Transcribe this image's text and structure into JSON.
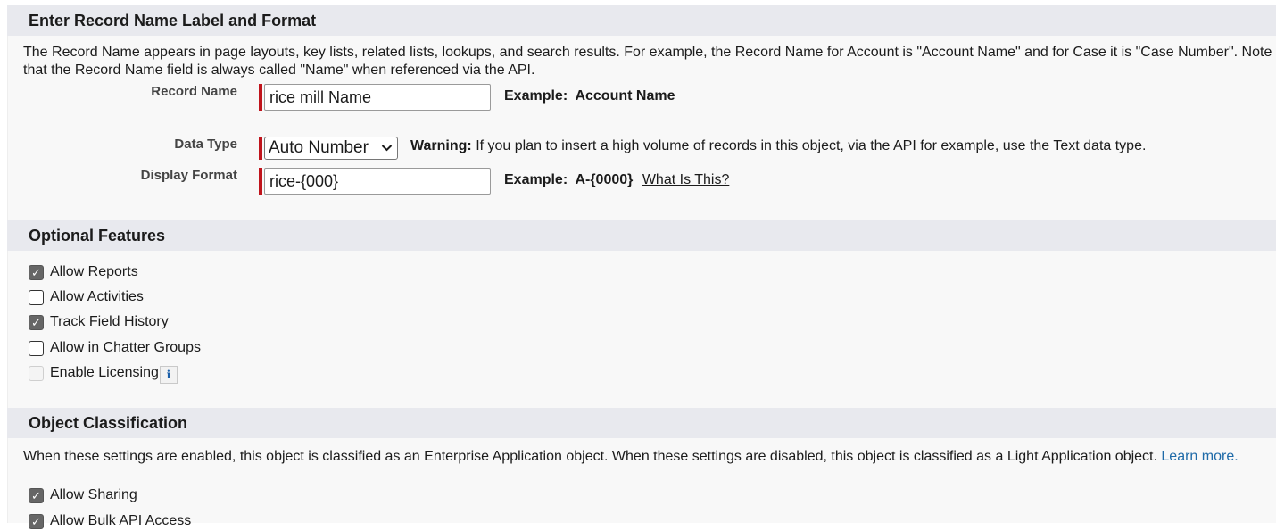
{
  "record_section": {
    "title": "Enter Record Name Label and Format",
    "description": "The Record Name appears in page layouts, key lists, related lists, lookups, and search results. For example, the Record Name for Account is \"Account Name\" and for Case it is \"Case Number\". Note that the Record Name field is always called \"Name\" when referenced via the API.",
    "record_name": {
      "label": "Record Name",
      "value": "rice mill Name",
      "example_prefix": "Example:",
      "example_value": "Account Name"
    },
    "data_type": {
      "label": "Data Type",
      "selected": "Auto Number",
      "warning_label": "Warning:",
      "warning_text": "If you plan to insert a high volume of records in this object, via the API for example, use the Text data type."
    },
    "display_format": {
      "label": "Display Format",
      "value": "rice-{000}",
      "example_prefix": "Example:",
      "example_value": "A-{0000}",
      "help_link": "What Is This?"
    }
  },
  "optional_section": {
    "title": "Optional Features",
    "items": [
      {
        "label": "Allow Reports",
        "checked": true,
        "disabled": false
      },
      {
        "label": "Allow Activities",
        "checked": false,
        "disabled": false
      },
      {
        "label": "Track Field History",
        "checked": true,
        "disabled": false
      },
      {
        "label": "Allow in Chatter Groups",
        "checked": false,
        "disabled": false
      },
      {
        "label": "Enable Licensing",
        "checked": false,
        "disabled": true
      }
    ],
    "info_icon": "info-icon"
  },
  "classification_section": {
    "title": "Object Classification",
    "description": "When these settings are enabled, this object is classified as an Enterprise Application object. When these settings are disabled, this object is classified as a Light Application object.",
    "learn_more": "Learn more.",
    "items": [
      {
        "label": "Allow Sharing",
        "checked": true
      },
      {
        "label": "Allow Bulk API Access",
        "checked": true
      }
    ]
  },
  "colors": {
    "required_bar": "#c0141c",
    "section_header_bg": "#e8e9ee",
    "link": "#1e6aa8"
  }
}
